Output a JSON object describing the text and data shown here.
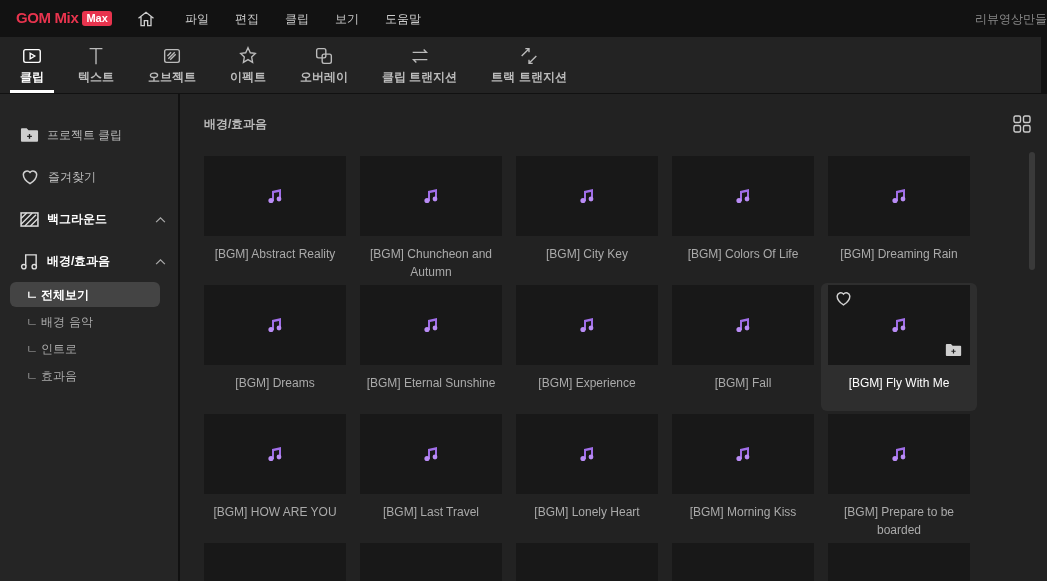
{
  "app": {
    "logo": "GOM Mix",
    "badge": "Max"
  },
  "menu": [
    "파일",
    "편집",
    "클립",
    "보기",
    "도움말"
  ],
  "user_text": "리뷰영상만들",
  "tabs": [
    {
      "label": "클립",
      "selected": true
    },
    {
      "label": "텍스트",
      "selected": false
    },
    {
      "label": "오브젝트",
      "selected": false
    },
    {
      "label": "이펙트",
      "selected": false
    },
    {
      "label": "오버레이",
      "selected": false
    },
    {
      "label": "클립 트랜지션",
      "selected": false
    },
    {
      "label": "트랙 트랜지션",
      "selected": false
    }
  ],
  "sidebar": {
    "items": [
      {
        "kind": "link",
        "label": "프로젝트 클립"
      },
      {
        "kind": "link",
        "label": "즐겨찾기"
      },
      {
        "kind": "category",
        "label": "백그라운드",
        "expanded": true
      },
      {
        "kind": "category",
        "label": "배경/효과음",
        "expanded": true,
        "children": [
          {
            "label": "ㄴ 전체보기",
            "selected": true
          },
          {
            "label": "ㄴ 배경 음악",
            "selected": false
          },
          {
            "label": "ㄴ 인트로",
            "selected": false
          },
          {
            "label": "ㄴ 효과음",
            "selected": false
          }
        ]
      }
    ]
  },
  "content": {
    "title": "배경/효과음",
    "items": [
      {
        "kind": "clip",
        "label": "[BGM] Abstract Reality",
        "selected": false
      },
      {
        "kind": "clip",
        "label": "[BGM] Chuncheon and Autumn",
        "selected": false
      },
      {
        "kind": "clip",
        "label": "[BGM] City Key",
        "selected": false
      },
      {
        "kind": "clip",
        "label": "[BGM] Colors Of Life",
        "selected": false
      },
      {
        "kind": "clip",
        "label": "[BGM] Dreaming Rain",
        "selected": false
      },
      {
        "kind": "clip",
        "label": "[BGM] Dreams",
        "selected": false
      },
      {
        "kind": "clip",
        "label": "[BGM] Eternal Sunshine",
        "selected": false
      },
      {
        "kind": "clip",
        "label": "[BGM] Experience",
        "selected": false
      },
      {
        "kind": "clip",
        "label": "[BGM] Fall",
        "selected": false
      },
      {
        "kind": "clip",
        "label": "[BGM] Fly With Me",
        "selected": true
      },
      {
        "kind": "clip",
        "label": "[BGM] HOW ARE YOU",
        "selected": false
      },
      {
        "kind": "clip",
        "label": "[BGM] Last Travel",
        "selected": false
      },
      {
        "kind": "clip",
        "label": "[BGM] Lonely Heart",
        "selected": false
      },
      {
        "kind": "clip",
        "label": "[BGM] Morning Kiss",
        "selected": false
      },
      {
        "kind": "clip",
        "label": "[BGM] Prepare to be boarded",
        "selected": false
      },
      {
        "kind": "partial"
      },
      {
        "kind": "partial"
      },
      {
        "kind": "partial"
      },
      {
        "kind": "partial"
      },
      {
        "kind": "partial"
      }
    ]
  }
}
